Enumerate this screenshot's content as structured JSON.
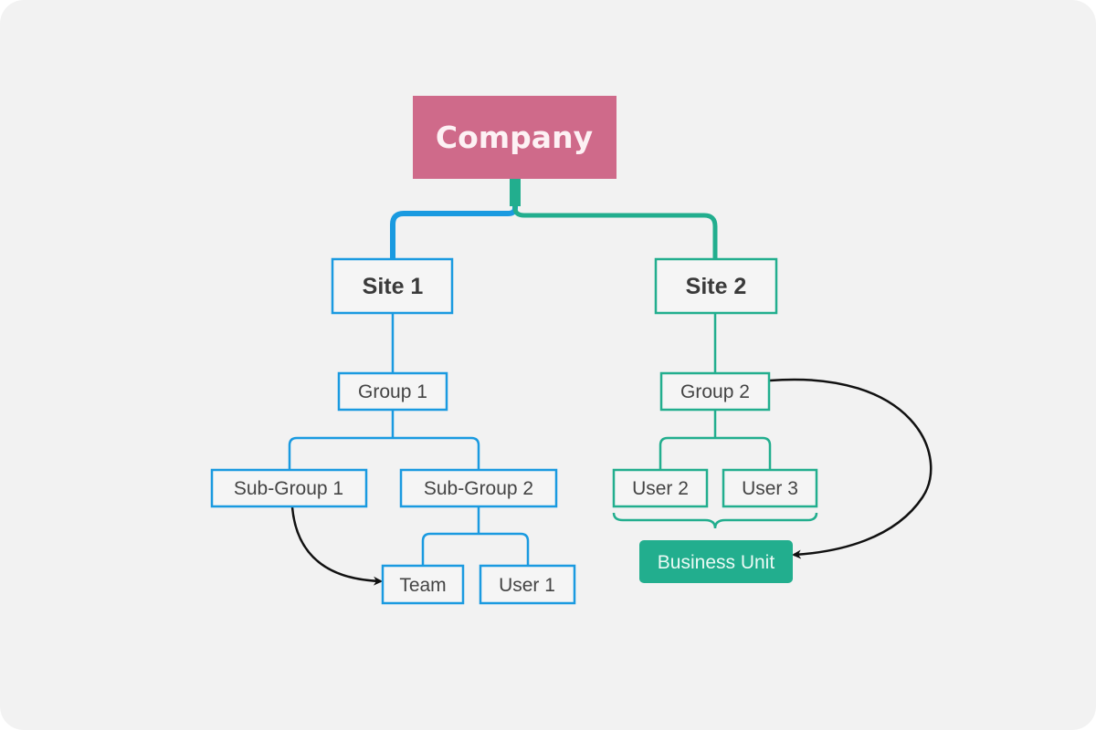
{
  "colors": {
    "root": "#cf6a8a",
    "site1_branch": "#1a9ae0",
    "site2_branch": "#22ae8e",
    "arrow": "#111111",
    "background": "#f2f2f2"
  },
  "nodes": {
    "company": "Company",
    "site1": "Site 1",
    "site2": "Site 2",
    "group1": "Group 1",
    "group2": "Group 2",
    "subgroup1": "Sub-Group 1",
    "subgroup2": "Sub-Group 2",
    "team": "Team",
    "user1": "User 1",
    "user2": "User 2",
    "user3": "User 3",
    "business_unit": "Business Unit"
  },
  "relations": [
    {
      "from": "Sub-Group 1",
      "to": "Team",
      "type": "arrow"
    },
    {
      "from": "Group 2",
      "to": "Business Unit",
      "type": "arrow"
    },
    {
      "from": "User 2 + User 3",
      "to": "Business Unit",
      "type": "brace"
    }
  ]
}
